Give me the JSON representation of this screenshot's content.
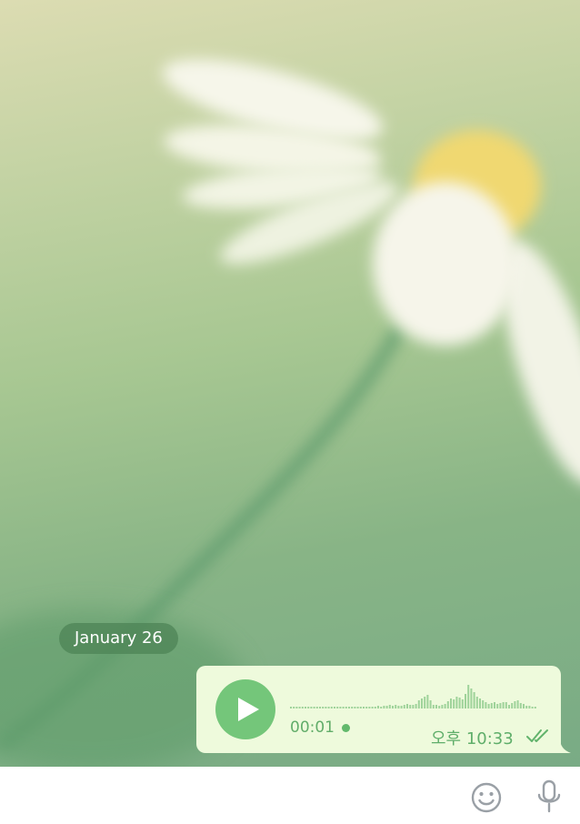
{
  "chat": {
    "date_separator": "January 26",
    "voice_message": {
      "duration": "00:01",
      "sent_time": "오후 10:33",
      "status": "read",
      "unheard": true
    }
  },
  "composer": {
    "emoji_icon": "smile-icon",
    "mic_icon": "microphone-icon"
  },
  "colors": {
    "bubble_bg": "#eefadc",
    "accent_green": "#74c67a",
    "date_pill": "#4c8254"
  }
}
